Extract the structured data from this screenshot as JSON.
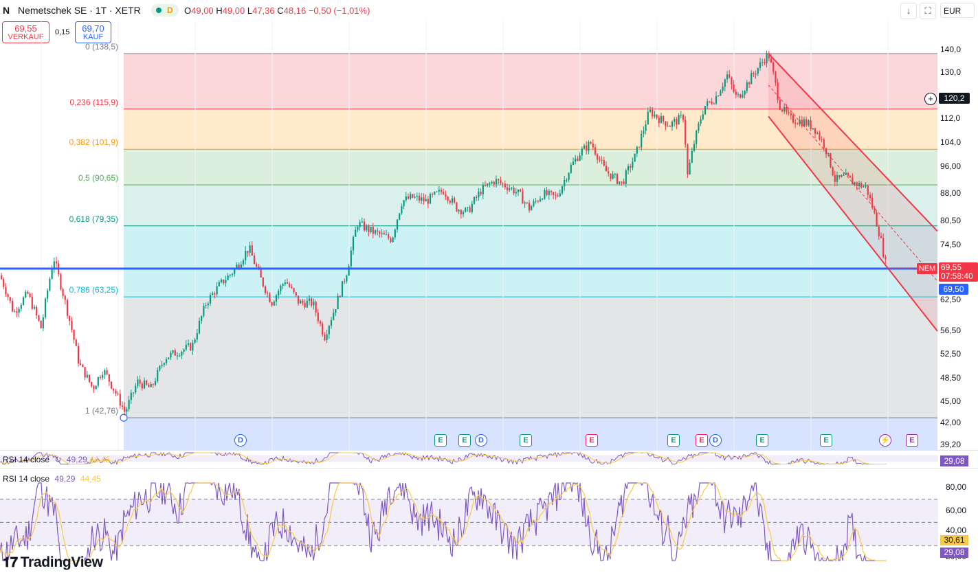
{
  "header": {
    "icon": "N",
    "symbol": "Nemetschek SE · 1T · XETR",
    "status_label": "D",
    "ohlc": [
      {
        "k": "O",
        "v": "49,00"
      },
      {
        "k": "H",
        "v": "49,00"
      },
      {
        "k": "L",
        "v": "47,36"
      },
      {
        "k": "C",
        "v": "48,16"
      },
      {
        "k": "",
        "v": "−0,50 (−1,01%)"
      }
    ],
    "sell_price": "69,55",
    "sell_label": "VERKAUF",
    "spread": "0,15",
    "buy_price": "69,70",
    "buy_label": "KAUF",
    "currency": "EUR"
  },
  "chart_data": {
    "type": "candlestick",
    "ylim": [
      39.2,
      140
    ],
    "price_axis": [
      "140,0",
      "130,0",
      "120,2",
      "112,0",
      "104,0",
      "96,00",
      "88,00",
      "80,50",
      "74,50",
      "69,55",
      "69,50",
      "62,50",
      "56,50",
      "52,50",
      "48,50",
      "45,00",
      "42,00",
      "39,20"
    ],
    "crosshair_price": "120,2",
    "last_price": "69,55",
    "countdown": "07:58:40",
    "horizontal_line": "69,50",
    "symbol_tag": "NEM",
    "fib_levels": [
      {
        "label": "0 (138,5)",
        "value": 138.5,
        "color": "#787b86"
      },
      {
        "label": "0,236 (115,9)",
        "value": 115.9,
        "color": "#f23645"
      },
      {
        "label": "0,382 (101,9)",
        "value": 101.9,
        "color": "#ff9800"
      },
      {
        "label": "0,5 (90,65)",
        "value": 90.65,
        "color": "#4caf50"
      },
      {
        "label": "0,618 (79,35)",
        "value": 79.35,
        "color": "#089981"
      },
      {
        "label": "0,786 (63,25)",
        "value": 63.25,
        "color": "#00bcd4"
      },
      {
        "label": "1 (42,76)",
        "value": 42.76,
        "color": "#787b86"
      }
    ],
    "price_path": [
      [
        0,
        68
      ],
      [
        20,
        60
      ],
      [
        40,
        64
      ],
      [
        60,
        57
      ],
      [
        78,
        72
      ],
      [
        95,
        62
      ],
      [
        115,
        51
      ],
      [
        135,
        47
      ],
      [
        150,
        50
      ],
      [
        170,
        46
      ],
      [
        182,
        43.5
      ],
      [
        200,
        48
      ],
      [
        220,
        47
      ],
      [
        240,
        52
      ],
      [
        260,
        53
      ],
      [
        280,
        54
      ],
      [
        300,
        62
      ],
      [
        320,
        66
      ],
      [
        340,
        69
      ],
      [
        362,
        74
      ],
      [
        380,
        67
      ],
      [
        395,
        62
      ],
      [
        415,
        67
      ],
      [
        435,
        62
      ],
      [
        455,
        62
      ],
      [
        472,
        55.5
      ],
      [
        490,
        62
      ],
      [
        505,
        69
      ],
      [
        520,
        80
      ],
      [
        540,
        78
      ],
      [
        555,
        77
      ],
      [
        570,
        76
      ],
      [
        585,
        86
      ],
      [
        600,
        87
      ],
      [
        620,
        86
      ],
      [
        645,
        89
      ],
      [
        665,
        84
      ],
      [
        680,
        83
      ],
      [
        700,
        89
      ],
      [
        720,
        92
      ],
      [
        740,
        90
      ],
      [
        755,
        88
      ],
      [
        770,
        84
      ],
      [
        790,
        88
      ],
      [
        810,
        87
      ],
      [
        830,
        96
      ],
      [
        845,
        101
      ],
      [
        860,
        104
      ],
      [
        880,
        95
      ],
      [
        905,
        91
      ],
      [
        925,
        100
      ],
      [
        945,
        115
      ],
      [
        960,
        112
      ],
      [
        975,
        110
      ],
      [
        995,
        113
      ],
      [
        1000,
        93
      ],
      [
        1010,
        104
      ],
      [
        1025,
        117
      ],
      [
        1040,
        120
      ],
      [
        1058,
        129
      ],
      [
        1072,
        120
      ],
      [
        1085,
        125
      ],
      [
        1100,
        131
      ],
      [
        1118,
        138.5
      ],
      [
        1135,
        117
      ],
      [
        1150,
        112
      ],
      [
        1170,
        111
      ],
      [
        1185,
        109
      ],
      [
        1200,
        103
      ],
      [
        1215,
        92
      ],
      [
        1230,
        93
      ],
      [
        1245,
        91
      ],
      [
        1260,
        90
      ],
      [
        1270,
        84
      ],
      [
        1280,
        77
      ],
      [
        1290,
        69.5
      ]
    ],
    "channel": {
      "upper": [
        [
          1118,
          138.5
        ],
        [
          1364,
          78
        ]
      ],
      "lower": [
        [
          1118,
          113
        ],
        [
          1364,
          56.5
        ]
      ]
    },
    "events": [
      {
        "type": "D",
        "x": 350
      },
      {
        "type": "E",
        "x": 641
      },
      {
        "type": "E",
        "x": 676
      },
      {
        "type": "D",
        "x": 700
      },
      {
        "type": "E",
        "x": 765
      },
      {
        "type": "E",
        "x": 861,
        "style": "red"
      },
      {
        "type": "E",
        "x": 980
      },
      {
        "type": "E",
        "x": 1021,
        "style": "red"
      },
      {
        "type": "D",
        "x": 1041
      },
      {
        "type": "E",
        "x": 1109
      },
      {
        "type": "E",
        "x": 1202
      },
      {
        "type": "S",
        "x": 1288
      },
      {
        "type": "E",
        "x": 1327,
        "style": "purple"
      }
    ],
    "rsi_mini": {
      "label": "RSI 14 close",
      "v1": "49,29",
      "v2": "44,45",
      "last": "29,08"
    },
    "rsi": {
      "label": "RSI 14 close",
      "v1": "49,29",
      "v2": "44,45",
      "axis": [
        "80,00",
        "60,00",
        "40,00",
        "30,61",
        "29,08",
        "20,00"
      ],
      "ylim": [
        15,
        88
      ],
      "ma_last": "30,61",
      "rsi_last": "29,08"
    }
  },
  "brand": {
    "name": "TradingView"
  }
}
